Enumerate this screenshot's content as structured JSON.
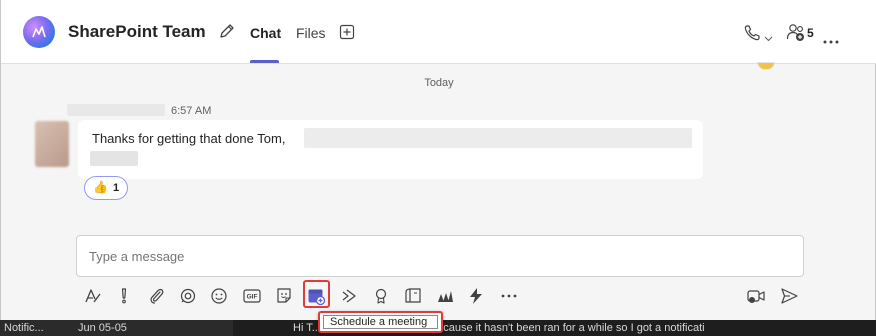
{
  "header": {
    "title": "SharePoint Team",
    "tabs": [
      {
        "label": "Chat",
        "selected": true
      },
      {
        "label": "Files",
        "selected": false
      }
    ],
    "participant_count": "5",
    "accent_color": "#5b5fc7"
  },
  "chat": {
    "day_separator": "Today",
    "message": {
      "time": "6:57 AM",
      "text": "Thanks for getting that done Tom,",
      "reaction": {
        "emoji": "👍",
        "count": "1"
      }
    }
  },
  "compose": {
    "placeholder": "Type a message",
    "toolbar_icons": [
      "format-icon",
      "important-icon",
      "attach-icon",
      "loop-icon",
      "emoji-icon",
      "gif-icon",
      "sticker-icon",
      "schedule-meeting-icon",
      "stream-icon",
      "praise-icon",
      "whiteboard-icon",
      "forms-icon",
      "approvals-icon",
      "more-options-icon",
      "meet-now-icon",
      "send-icon"
    ]
  },
  "tooltip": {
    "label": "Schedule a meeting",
    "highlight_color": "#e03b3b"
  },
  "taskbar": {
    "left_1": "Notific...",
    "left_2": "Jun 05-05",
    "text": "Hi T...w and the reason was because it hasn't been ran for a while so I got a notificati"
  }
}
